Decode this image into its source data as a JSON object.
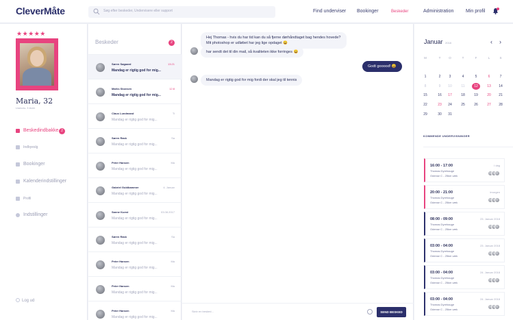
{
  "app": {
    "logo": "CleverMåte"
  },
  "search": {
    "placeholder": "Søg efter beskeder, Undervisere eller support"
  },
  "nav": [
    {
      "label": "Find underviser",
      "active": false
    },
    {
      "label": "Bookinger",
      "active": false
    },
    {
      "label": "Beskeder",
      "active": true
    },
    {
      "label": "Administration",
      "active": false
    },
    {
      "label": "Min profil",
      "active": false
    }
  ],
  "profile": {
    "stars": "★★★★★",
    "name": "Maria, 32",
    "subtitle": "Lisecdu- 3 lever"
  },
  "sidebar": {
    "items": [
      {
        "label": "Beskedindbakke",
        "badge": "2",
        "active": true,
        "icon": "chat-icon"
      },
      {
        "label": "Indbyeslg",
        "active": false,
        "icon": "grid-icon"
      },
      {
        "label": "Bookinger",
        "active": false,
        "icon": "calendar-icon"
      },
      {
        "label": "Kalenderindstillinger",
        "active": false,
        "icon": "calendar-settings-icon"
      },
      {
        "label": "Profil",
        "active": false,
        "icon": "headset-icon"
      },
      {
        "label": "Indstillinger",
        "active": false,
        "icon": "gear-icon"
      }
    ],
    "logout": "Log ud"
  },
  "conversations": {
    "title": "Beskeder",
    "badge": "2",
    "items": [
      {
        "name": "Søren Søgaard",
        "time": "13:21",
        "preview": "Mandag er rigtig god for mig...",
        "unread": true,
        "active": true
      },
      {
        "name": "Marks Skovsen",
        "time": "12:8",
        "preview": "Mandag er rigtig god for mig...",
        "unread": true,
        "active": false
      },
      {
        "name": "Claus Lundmand",
        "time": "Ti",
        "preview": "Mandag er rigtig god for mig...",
        "unread": false,
        "active": false
      },
      {
        "name": "Søren Rask",
        "time": "Sa",
        "preview": "Mandag er rigtig god for mig...",
        "unread": false,
        "active": false
      },
      {
        "name": "Peter Hansen",
        "time": "Ma",
        "preview": "Mandag er rigtig god for mig...",
        "unread": false,
        "active": false
      },
      {
        "name": "Gabriel Guldbammer",
        "time": "4. Januar",
        "preview": "Mandag er rigtig god for mig...",
        "unread": false,
        "active": false
      },
      {
        "name": "Sanne Kuest",
        "time": "03.08.2017",
        "preview": "Mandag er rigtig god for mig...",
        "unread": false,
        "active": false
      },
      {
        "name": "Søren Rask",
        "time": "Sa",
        "preview": "Mandag er rigtig god for mig...",
        "unread": false,
        "active": false
      },
      {
        "name": "Peter Hansen",
        "time": "Ma",
        "preview": "Mandag er rigtig god for mig...",
        "unread": false,
        "active": false
      },
      {
        "name": "Peter Hansen",
        "time": "Ma",
        "preview": "Mandag er rigtig god for mig...",
        "unread": false,
        "active": false
      },
      {
        "name": "Peter Hansen",
        "time": "Ma",
        "preview": "Mandag er rigtig god for mig...",
        "unread": false,
        "active": false
      }
    ]
  },
  "chat": {
    "messages": [
      {
        "line1": "Hej Thomas - hvis du har tid kan du så fjerne dørhåndtaget bag hendes hovede?",
        "line2": "Mit photoshop er udløbet har jeg lige opdaget 😄",
        "direction": "in"
      },
      {
        "line1": "har sendt det til din mail, så kvaliteten ikke forringes 😄",
        "direction": "in"
      },
      {
        "line1": "Godt gooood! 😄",
        "direction": "out"
      },
      {
        "line1": "Mandag er rigtig god for mig fordi der skal jeg til tennis",
        "direction": "in"
      }
    ],
    "input_placeholder": "Skriv en besked...",
    "send_label": "SEND BESKED"
  },
  "calendar": {
    "month": "Januar",
    "year": "2018",
    "weekdays": [
      "M",
      "T",
      "O",
      "T",
      "F",
      "L",
      "S"
    ],
    "weeks": [
      [
        {
          "d": "1"
        },
        {
          "d": "2"
        },
        {
          "d": "3"
        },
        {
          "d": "4"
        },
        {
          "d": "5"
        },
        {
          "d": "6",
          "pink": true
        },
        {
          "d": "7"
        }
      ],
      [
        {
          "d": "8",
          "muted": true
        },
        {
          "d": "9",
          "muted": true
        },
        {
          "d": "10",
          "muted": true
        },
        {
          "d": "11",
          "muted": true
        },
        {
          "d": "12",
          "today": true
        },
        {
          "d": "13",
          "pink": true
        },
        {
          "d": "14"
        }
      ],
      [
        {
          "d": "15"
        },
        {
          "d": "16"
        },
        {
          "d": "17",
          "pink": true
        },
        {
          "d": "18"
        },
        {
          "d": "19"
        },
        {
          "d": "20",
          "pink": true
        },
        {
          "d": "21"
        }
      ],
      [
        {
          "d": "22"
        },
        {
          "d": "23",
          "pink": true
        },
        {
          "d": "24"
        },
        {
          "d": "25"
        },
        {
          "d": "26"
        },
        {
          "d": "27",
          "pink": true
        },
        {
          "d": "28"
        }
      ],
      [
        {
          "d": "29"
        },
        {
          "d": "30"
        },
        {
          "d": "31"
        }
      ]
    ],
    "upcoming_title": "KOMMENDE UNDERVISNINGER"
  },
  "lessons": [
    {
      "time": "16:00 - 17:00",
      "date": "I dag",
      "name": "Thomas Dyrehauge",
      "location": "Odense C - 25km væk",
      "accent": "pink"
    },
    {
      "time": "20:00 - 21:00",
      "date": "Imorgen",
      "name": "Thomas Dyrehauge",
      "location": "Odense C - 25km væk",
      "accent": "pink"
    },
    {
      "time": "08:00 - 09:00",
      "date": "23. Januar 2018",
      "name": "Thomas Dyrehauge",
      "location": "Odense C - 25km væk",
      "accent": "navy"
    },
    {
      "time": "03:00 - 04:00",
      "date": "23. Januar 2018",
      "name": "Thomas Dyrehauge",
      "location": "Odense C - 25km væk",
      "accent": "navy"
    },
    {
      "time": "03:00 - 04:00",
      "date": "24. Januar 2018",
      "name": "Thomas Dyrehauge",
      "location": "Odense C - 25km væk",
      "accent": "navy"
    },
    {
      "time": "03:00 - 04:00",
      "date": "24. Januar 2018",
      "name": "Thomas Dyrehauge",
      "location": "Odense C - 25km væk",
      "accent": "navy"
    }
  ],
  "colors": {
    "accent": "#e8437f",
    "brand": "#2b2f6b"
  }
}
